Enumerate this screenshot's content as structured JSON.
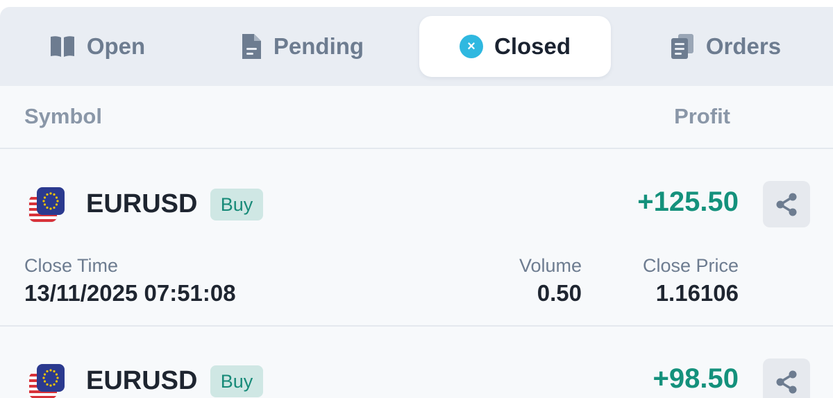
{
  "tabs": [
    {
      "label": "Open",
      "icon": "book-icon",
      "active": false
    },
    {
      "label": "Pending",
      "icon": "document-icon",
      "active": false
    },
    {
      "label": "Closed",
      "icon": "close-circle-icon",
      "active": true
    },
    {
      "label": "Orders",
      "icon": "clipboard-stack-icon",
      "active": false
    }
  ],
  "closed_glyph": "×",
  "columns": {
    "symbol": "Symbol",
    "profit": "Profit"
  },
  "trades": [
    {
      "symbol": "EURUSD",
      "side": "Buy",
      "profit": "+125.50",
      "close_time_label": "Close Time",
      "close_time": "13/11/2025 07:51:08",
      "volume_label": "Volume",
      "volume": "0.50",
      "close_price_label": "Close Price",
      "close_price": "1.16106"
    },
    {
      "symbol": "EURUSD",
      "side": "Buy",
      "profit": "+98.50"
    }
  ],
  "colors": {
    "accent_active": "#2fb8e0",
    "profit_green": "#14917c",
    "buy_badge_bg": "#cfe7e4",
    "tab_bar_bg": "#e9edf3",
    "muted_text": "#6d7c90"
  }
}
